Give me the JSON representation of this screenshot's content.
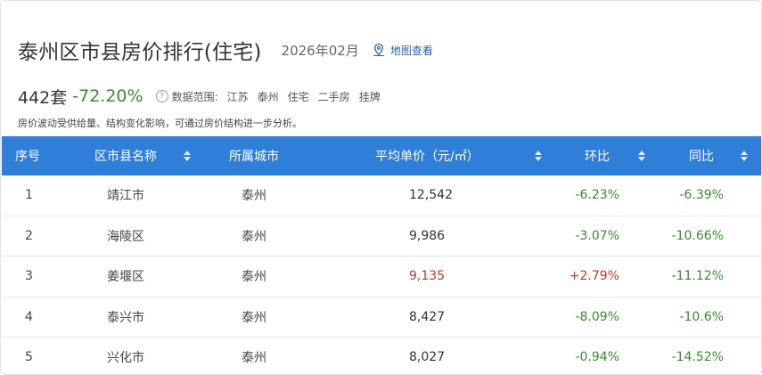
{
  "header": {
    "title": "泰州区市县房价排行(住宅)",
    "date": "2026年02月",
    "map_link": "地图查看"
  },
  "summary": {
    "count": "442套",
    "change": "-72.20%",
    "scope_label": "数据范围:",
    "scope_tags": [
      "江苏",
      "泰州",
      "住宅",
      "二手房",
      "挂牌"
    ],
    "note": "房价波动受供给量、结构变化影响，可通过房价结构进一步分析。"
  },
  "table": {
    "columns": {
      "rank": "序号",
      "district": "区市县名称",
      "city": "所属城市",
      "price": "平均单价（元/㎡）",
      "mom": "环比",
      "yoy": "同比"
    },
    "rows": [
      {
        "rank": "1",
        "district": "靖江市",
        "city": "泰州",
        "price": "12,542",
        "mom": "-6.23%",
        "yoy": "-6.39%"
      },
      {
        "rank": "2",
        "district": "海陵区",
        "city": "泰州",
        "price": "9,986",
        "mom": "-3.07%",
        "yoy": "-10.66%"
      },
      {
        "rank": "3",
        "district": "姜堰区",
        "city": "泰州",
        "price": "9,135",
        "mom": "+2.79%",
        "yoy": "-11.12%"
      },
      {
        "rank": "4",
        "district": "泰兴市",
        "city": "泰州",
        "price": "8,427",
        "mom": "-8.09%",
        "yoy": "-10.6%"
      },
      {
        "rank": "5",
        "district": "兴化市",
        "city": "泰州",
        "price": "8,027",
        "mom": "-0.94%",
        "yoy": "-14.52%"
      }
    ]
  },
  "colors": {
    "header_bg": "#2f7ed8",
    "negative": "#3a8a30",
    "positive": "#c0392b",
    "link": "#2b62ad"
  }
}
